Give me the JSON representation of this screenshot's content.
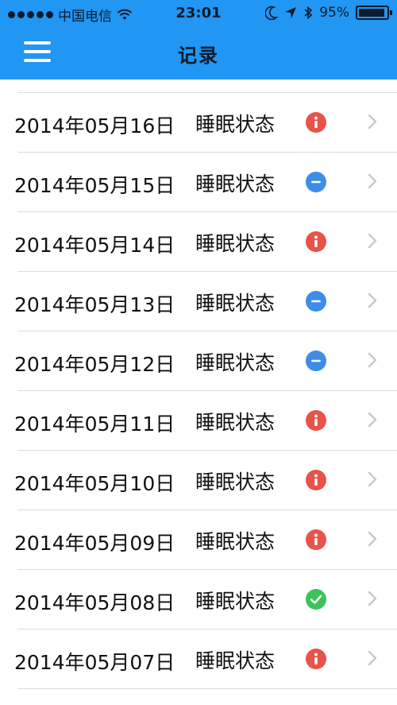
{
  "status_bar": {
    "carrier": "中国电信",
    "time": "23:01",
    "battery_percent": "95%",
    "battery_level": 0.95
  },
  "nav": {
    "title": "记录",
    "menu_icon": "hamburger-menu-icon"
  },
  "records": [
    {
      "date": "2014年05月16日",
      "label": "睡眠状态",
      "status": "warning",
      "icon": "info-icon",
      "color": "#e8534a"
    },
    {
      "date": "2014年05月15日",
      "label": "睡眠状态",
      "status": "neutral",
      "icon": "minus-icon",
      "color": "#3d8de8"
    },
    {
      "date": "2014年05月14日",
      "label": "睡眠状态",
      "status": "warning",
      "icon": "info-icon",
      "color": "#e8534a"
    },
    {
      "date": "2014年05月13日",
      "label": "睡眠状态",
      "status": "neutral",
      "icon": "minus-icon",
      "color": "#3d8de8"
    },
    {
      "date": "2014年05月12日",
      "label": "睡眠状态",
      "status": "neutral",
      "icon": "minus-icon",
      "color": "#3d8de8"
    },
    {
      "date": "2014年05月11日",
      "label": "睡眠状态",
      "status": "warning",
      "icon": "info-icon",
      "color": "#e8534a"
    },
    {
      "date": "2014年05月10日",
      "label": "睡眠状态",
      "status": "warning",
      "icon": "info-icon",
      "color": "#e8534a"
    },
    {
      "date": "2014年05月09日",
      "label": "睡眠状态",
      "status": "warning",
      "icon": "info-icon",
      "color": "#e8534a"
    },
    {
      "date": "2014年05月08日",
      "label": "睡眠状态",
      "status": "good",
      "icon": "check-icon",
      "color": "#3cc45a"
    },
    {
      "date": "2014年05月07日",
      "label": "睡眠状态",
      "status": "warning",
      "icon": "info-icon",
      "color": "#e8534a"
    }
  ],
  "colors": {
    "header": "#2196f3",
    "separator": "#dcdcdc",
    "chevron": "#c7c7cc"
  }
}
